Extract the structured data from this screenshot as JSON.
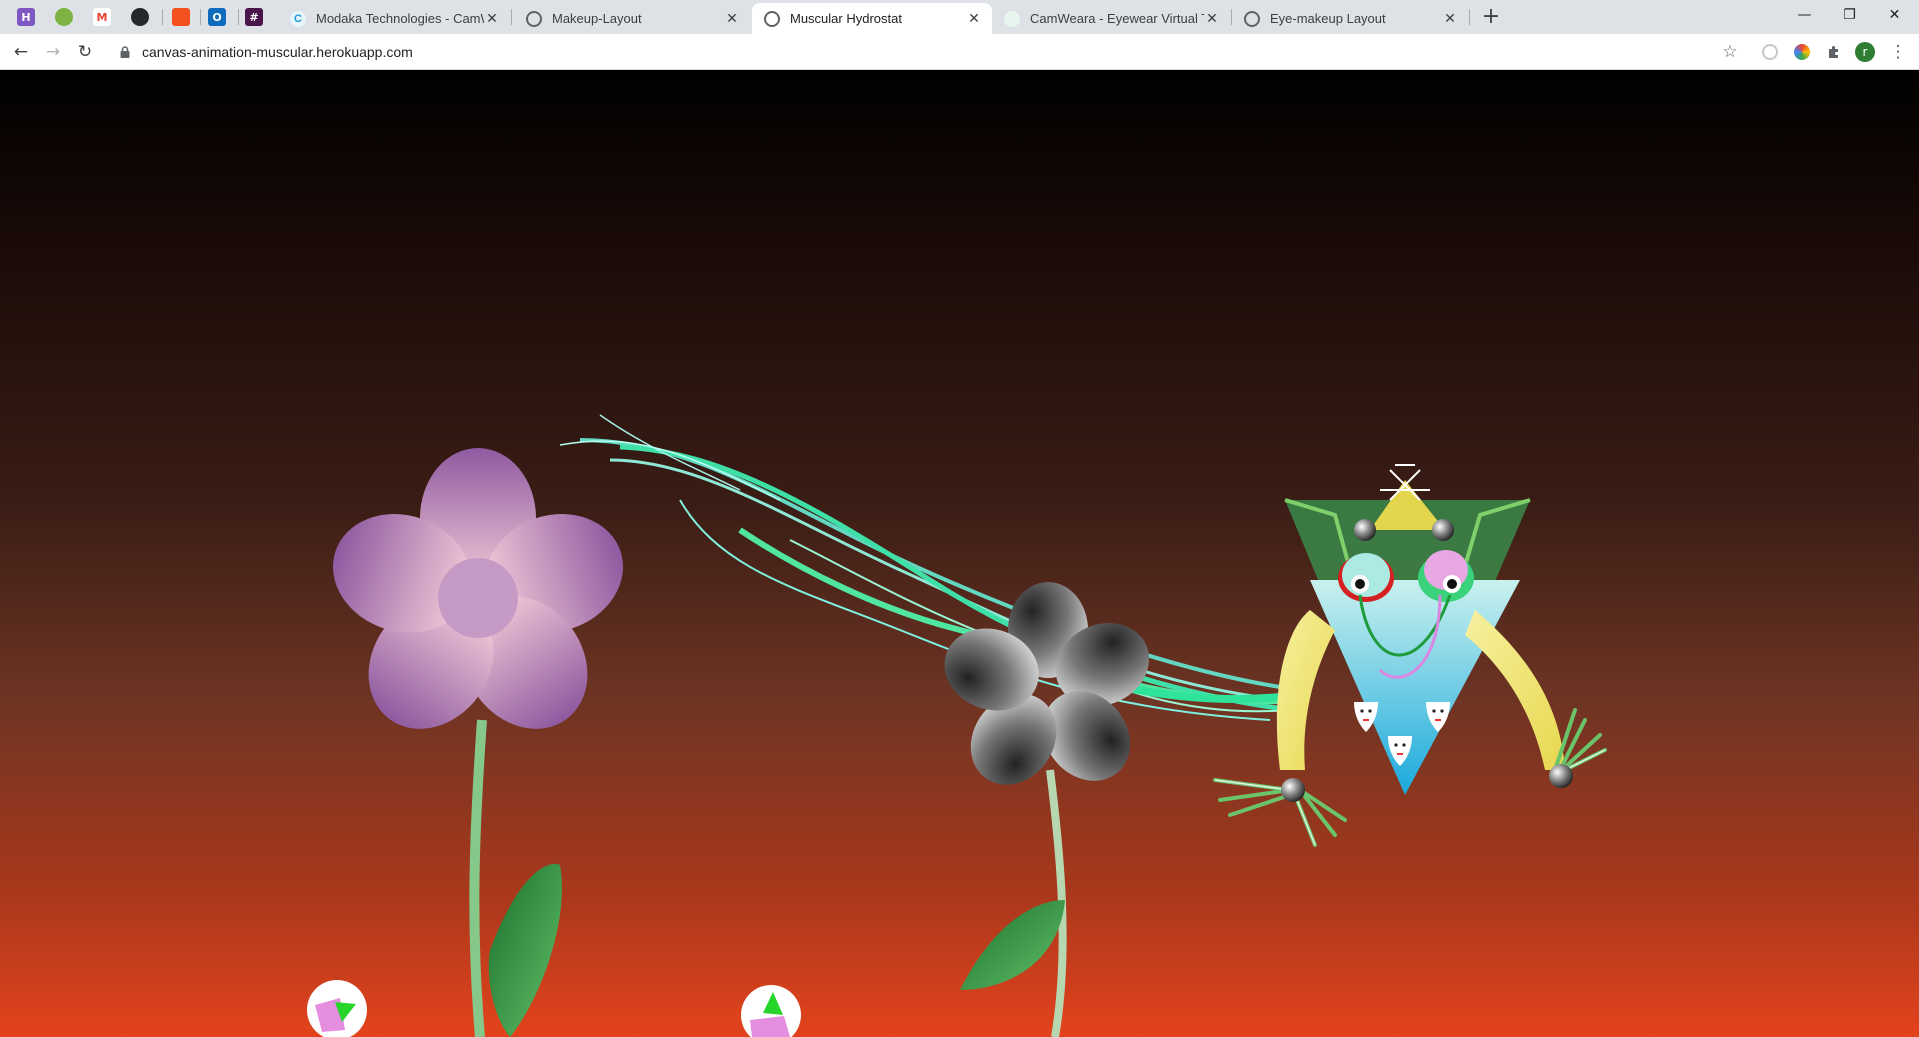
{
  "browser": {
    "pinned_tabs": [
      {
        "name": "pinned-tab-h",
        "glyph": "H",
        "color": "#7e57c2"
      },
      {
        "name": "pinned-tab-green",
        "glyph": "",
        "color": "#7cb342"
      },
      {
        "name": "pinned-tab-gmail",
        "glyph": "M",
        "color": "#ea4335"
      },
      {
        "name": "pinned-tab-github",
        "glyph": "",
        "color": "#24292e"
      },
      {
        "name": "pinned-tab-orange",
        "glyph": "",
        "color": "#f4511e"
      },
      {
        "name": "pinned-tab-outlook",
        "glyph": "O",
        "color": "#0f6cbd"
      },
      {
        "name": "pinned-tab-slack",
        "glyph": "#",
        "color": "#4a154b"
      }
    ],
    "tabs": [
      {
        "title": "Modaka Technologies - CamWeara",
        "active": false
      },
      {
        "title": "Makeup-Layout",
        "active": false
      },
      {
        "title": "Muscular Hydrostat",
        "active": true
      },
      {
        "title": "CamWeara - Eyewear Virtual Try On",
        "active": false
      },
      {
        "title": "Eye-makeup Layout",
        "active": false
      }
    ],
    "url": "canvas-animation-muscular.herokuapp.com",
    "profile_initial": "r"
  },
  "scene": {
    "background_top": "#000000",
    "background_bottom": "#e3431c",
    "pink_flower_color": "#b37bb0",
    "tentacle_color": "#4fe3b0",
    "creature_body_color": "#2fb3e0",
    "creature_arm_color": "#f0e078"
  }
}
